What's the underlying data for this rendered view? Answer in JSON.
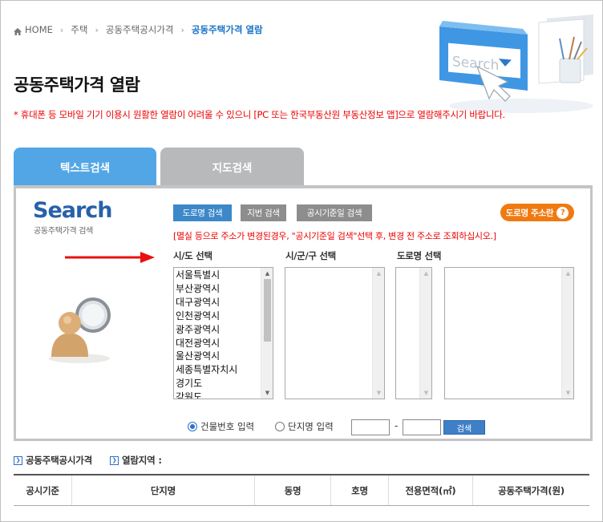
{
  "breadcrumb": {
    "home": "HOME",
    "items": [
      "주택",
      "공동주택공시가격",
      "공동주택가격 열람"
    ]
  },
  "hero": {
    "search_word": "Search"
  },
  "page_title": "공동주택가격 열람",
  "notice": "* 휴대폰 등 모바일 기기 이용시 원활한 열람이 어려울 수 있으니 [PC 또는 한국부동산원 부동산정보 앱]으로 열람해주시기 바랍니다.",
  "tabs": [
    {
      "label": "텍스트검색",
      "active": true
    },
    {
      "label": "지도검색",
      "active": false
    }
  ],
  "search_panel": {
    "title": "Search",
    "subtitle": "공동주택가격 검색",
    "mode_buttons": [
      "도로명 검색",
      "지번 검색",
      "공시기준일 검색"
    ],
    "guide_button": "도로명 주소란",
    "guide_icon_text": "?",
    "warning": "[멸실 등으로 주소가 변경된경우, \"공시기준일 검색\"선택 후, 변경 전 주소로 조회하십시오.]",
    "labels": {
      "sido": "시/도 선택",
      "sigungu": "시/군/구 선택",
      "road": "도로명 선택"
    },
    "sido_options": [
      "서울특별시",
      "부산광역시",
      "대구광역시",
      "인천광역시",
      "광주광역시",
      "대전광역시",
      "울산광역시",
      "세종특별자치시",
      "경기도",
      "강원도"
    ],
    "radio": {
      "building": "건물번호 입력",
      "complex": "단지명 입력",
      "selected": "building"
    },
    "num_sep": "-",
    "search_button": "검색"
  },
  "bottom": {
    "heading_price": "공동주택공시가격",
    "heading_area": "열람지역 :",
    "table_headers": [
      "공시기준",
      "단지명",
      "동명",
      "호명",
      "전용면적(㎡)",
      "공동주택가격(원)"
    ]
  },
  "colors": {
    "accent_blue": "#53a6e6",
    "tab_inactive": "#b8b9bb",
    "warning_red": "#e00000",
    "guide_orange": "#f07a10",
    "breadcrumb_active": "#1a73c7"
  }
}
